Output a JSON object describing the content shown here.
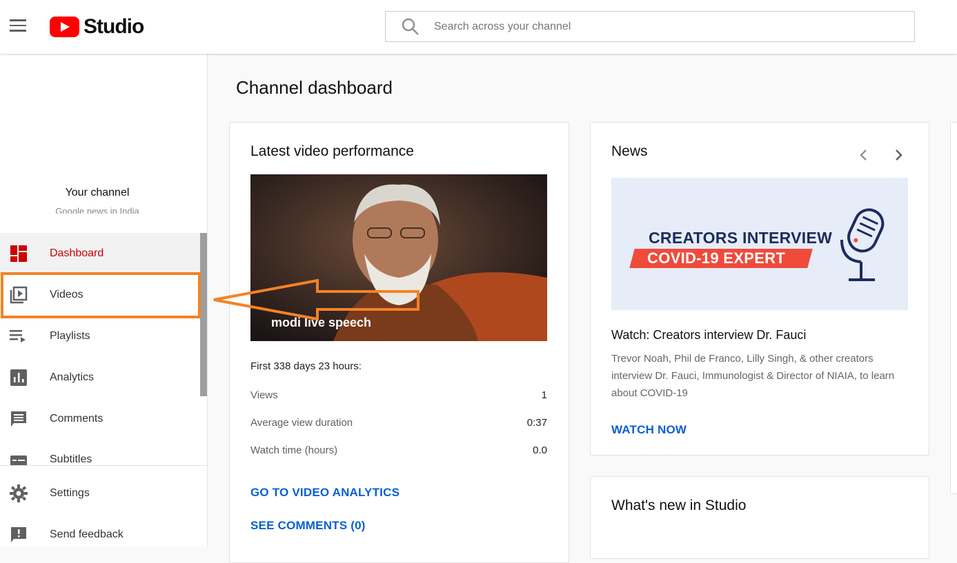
{
  "header": {
    "logo_text": "Studio",
    "search_placeholder": "Search across your channel"
  },
  "sidebar": {
    "channel_label": "Your channel",
    "channel_sub": "Google news in India",
    "items": [
      {
        "label": "Dashboard",
        "icon": "dashboard-icon"
      },
      {
        "label": "Videos",
        "icon": "videos-icon"
      },
      {
        "label": "Playlists",
        "icon": "playlists-icon"
      },
      {
        "label": "Analytics",
        "icon": "analytics-icon"
      },
      {
        "label": "Comments",
        "icon": "comments-icon"
      },
      {
        "label": "Subtitles",
        "icon": "subtitles-icon"
      }
    ],
    "bottom": [
      {
        "label": "Settings",
        "icon": "gear-icon"
      },
      {
        "label": "Send feedback",
        "icon": "feedback-icon"
      }
    ]
  },
  "main": {
    "title": "Channel dashboard",
    "latest": {
      "heading": "Latest video performance",
      "video_title": "modi live speech",
      "period": "First 338 days 23 hours:",
      "stats": [
        {
          "label": "Views",
          "value": "1"
        },
        {
          "label": "Average view duration",
          "value": "0:37"
        },
        {
          "label": "Watch time (hours)",
          "value": "0.0"
        }
      ],
      "analytics_link": "GO TO VIDEO ANALYTICS",
      "comments_link": "SEE COMMENTS (0)"
    },
    "news": {
      "heading": "News",
      "banner_line1": "CREATORS INTERVIEW",
      "banner_line2": "COVID-19 EXPERT",
      "article_title": "Watch: Creators interview Dr. Fauci",
      "article_desc": "Trevor Noah, Phil de Franco, Lilly Singh, & other creators interview Dr. Fauci, Immunologist & Director of NIAIA, to learn about COVID-19",
      "cta": "WATCH NOW"
    },
    "whats_new": {
      "heading": "What's new in Studio"
    }
  },
  "colors": {
    "brand_red": "#ff0000",
    "active_red": "#cc0000",
    "link_blue": "#065fd4",
    "annotation_orange": "#f48225"
  }
}
